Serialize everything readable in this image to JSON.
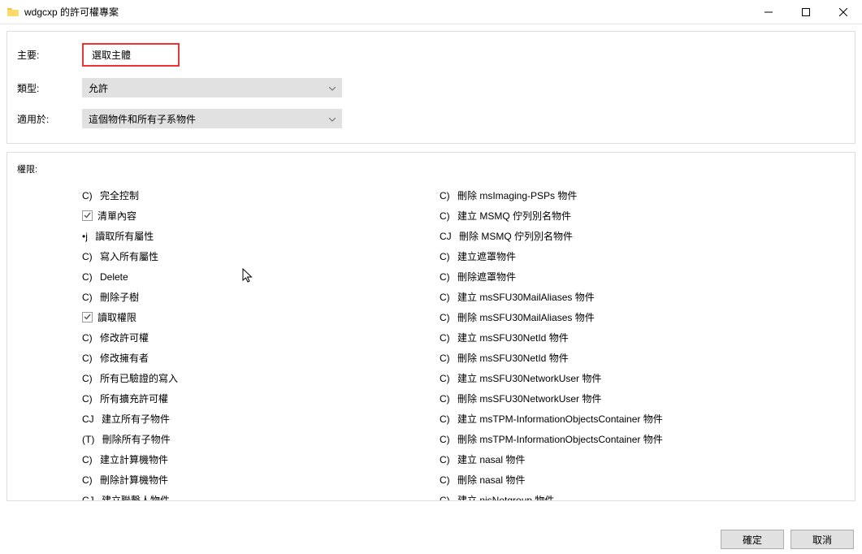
{
  "window": {
    "title": "wdgcxp 的許可權專案"
  },
  "form": {
    "principal_label": "主要:",
    "principal_value": "選取主體",
    "type_label": "類型:",
    "type_value": "允許",
    "applies_label": "適用於:",
    "applies_value": "這個物件和所有子系物件"
  },
  "perm_header": "權限:",
  "left": [
    {
      "prefix": "C) ",
      "label": "完全控制",
      "cb": false
    },
    {
      "prefix": "",
      "label": "清單內容",
      "cb": true,
      "checked": true
    },
    {
      "prefix": "•j ",
      "label": "讀取所有屬性",
      "cb": false
    },
    {
      "prefix": "C) ",
      "label": "寫入所有屬性",
      "cb": false
    },
    {
      "prefix": "C) ",
      "label": "Delete",
      "cb": false
    },
    {
      "prefix": "C) ",
      "label": "刪除子樹",
      "cb": false
    },
    {
      "prefix": "",
      "label": "讀取權限",
      "cb": true,
      "checked": true
    },
    {
      "prefix": "C) ",
      "label": "修改許可權",
      "cb": false
    },
    {
      "prefix": "C) ",
      "label": "修改擁有者",
      "cb": false
    },
    {
      "prefix": "C) ",
      "label": "所有已驗證的寫入",
      "cb": false
    },
    {
      "prefix": "C) ",
      "label": "所有擴充許可權",
      "cb": false
    },
    {
      "prefix": "CJ ",
      "label": "建立所有子物件",
      "cb": false
    },
    {
      "prefix": "(T) ",
      "label": "刪除所有子物件",
      "cb": false
    },
    {
      "prefix": "C) ",
      "label": "建立計算機物件",
      "cb": false
    },
    {
      "prefix": "C) ",
      "label": "刪除計算機物件",
      "cb": false
    },
    {
      "prefix": "CJ ",
      "label": "建立聯繫人物件",
      "cb": false
    }
  ],
  "right": [
    {
      "prefix": "C) ",
      "label": "刪除 msImaging-PSPs 物件",
      "cb": false
    },
    {
      "prefix": "C) ",
      "label": "建立 MSMQ 佇列別名物件",
      "cb": false
    },
    {
      "prefix": "CJ ",
      "label": "刪除 MSMQ 佇列別名物件",
      "cb": false
    },
    {
      "prefix": "C) ",
      "label": "建立遮罩物件",
      "cb": false
    },
    {
      "prefix": "C) ",
      "label": "刪除遮罩物件",
      "cb": false
    },
    {
      "prefix": "C) ",
      "label": "建立 msSFU30MailAliases 物件",
      "cb": false
    },
    {
      "prefix": "C) ",
      "label": "刪除 msSFU30MailAliases 物件",
      "cb": false
    },
    {
      "prefix": "C) ",
      "label": "建立 msSFU30NetId 物件",
      "cb": false
    },
    {
      "prefix": "C) ",
      "label": "刪除 msSFU30NetId 物件",
      "cb": false
    },
    {
      "prefix": "C) ",
      "label": "建立 msSFU30NetworkUser 物件",
      "cb": false
    },
    {
      "prefix": "C) ",
      "label": "刪除 msSFU30NetworkUser 物件",
      "cb": false
    },
    {
      "prefix": "C) ",
      "label": "建立 msTPM-InformationObjectsContainer 物件",
      "cb": false
    },
    {
      "prefix": "C) ",
      "label": "刪除 msTPM-InformationObjectsContainer 物件",
      "cb": false
    },
    {
      "prefix": "C) ",
      "label": "建立 nasal 物件",
      "cb": false
    },
    {
      "prefix": "C) ",
      "label": "刪除 nasal 物件",
      "cb": false
    },
    {
      "prefix": "C) ",
      "label": "建立 nisNetgroup 物件",
      "cb": false
    }
  ],
  "buttons": {
    "ok": "確定",
    "cancel": "取消"
  }
}
